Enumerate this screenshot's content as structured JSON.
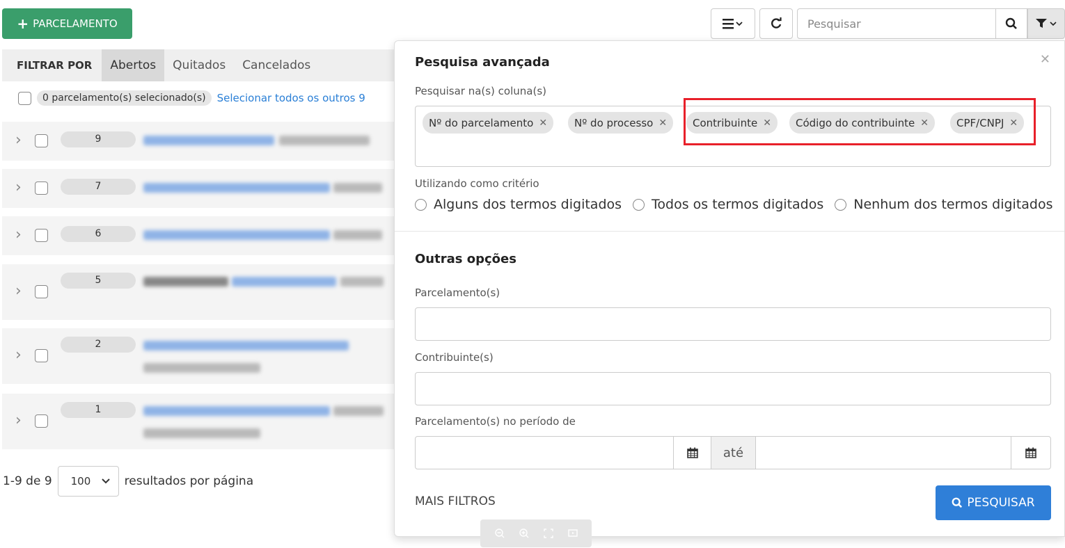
{
  "header": {
    "new_button_label": "PARCELAMENTO",
    "search_placeholder": "Pesquisar"
  },
  "filter": {
    "label": "FILTRAR POR",
    "tabs": [
      "Abertos",
      "Quitados",
      "Cancelados"
    ],
    "active_tab": "Abertos"
  },
  "selection": {
    "count_text": "0 parcelamento(s) selecionado(s)",
    "select_all_link": "Selecionar todos os outros 9"
  },
  "rows": [
    {
      "number": "9"
    },
    {
      "number": "7"
    },
    {
      "number": "6"
    },
    {
      "number": "5"
    },
    {
      "number": "2"
    },
    {
      "number": "1"
    }
  ],
  "pagination": {
    "range": "1-9 de 9",
    "per_page": "100",
    "per_page_label": "resultados por página"
  },
  "advanced_search": {
    "title": "Pesquisa avançada",
    "columns_label": "Pesquisar na(s) coluna(s)",
    "tags": [
      "Nº do parcelamento",
      "Nº do processo",
      "Contribuinte",
      "Código do contribuinte",
      "CPF/CNPJ"
    ],
    "criteria_label": "Utilizando como critério",
    "criteria_options": [
      "Alguns dos termos digitados",
      "Todos os termos digitados",
      "Nenhum dos termos digitados"
    ],
    "other_options_title": "Outras opções",
    "parcelamento_label": "Parcelamento(s)",
    "contribuinte_label": "Contribuinte(s)",
    "period_label": "Parcelamento(s) no período de",
    "date_separator": "até",
    "more_filters": "MAIS FILTROS",
    "search_button": "PESQUISAR"
  },
  "colors": {
    "primary_green": "#3a9e6b",
    "primary_blue": "#2f7fd8",
    "highlight_red": "#e8202a"
  }
}
